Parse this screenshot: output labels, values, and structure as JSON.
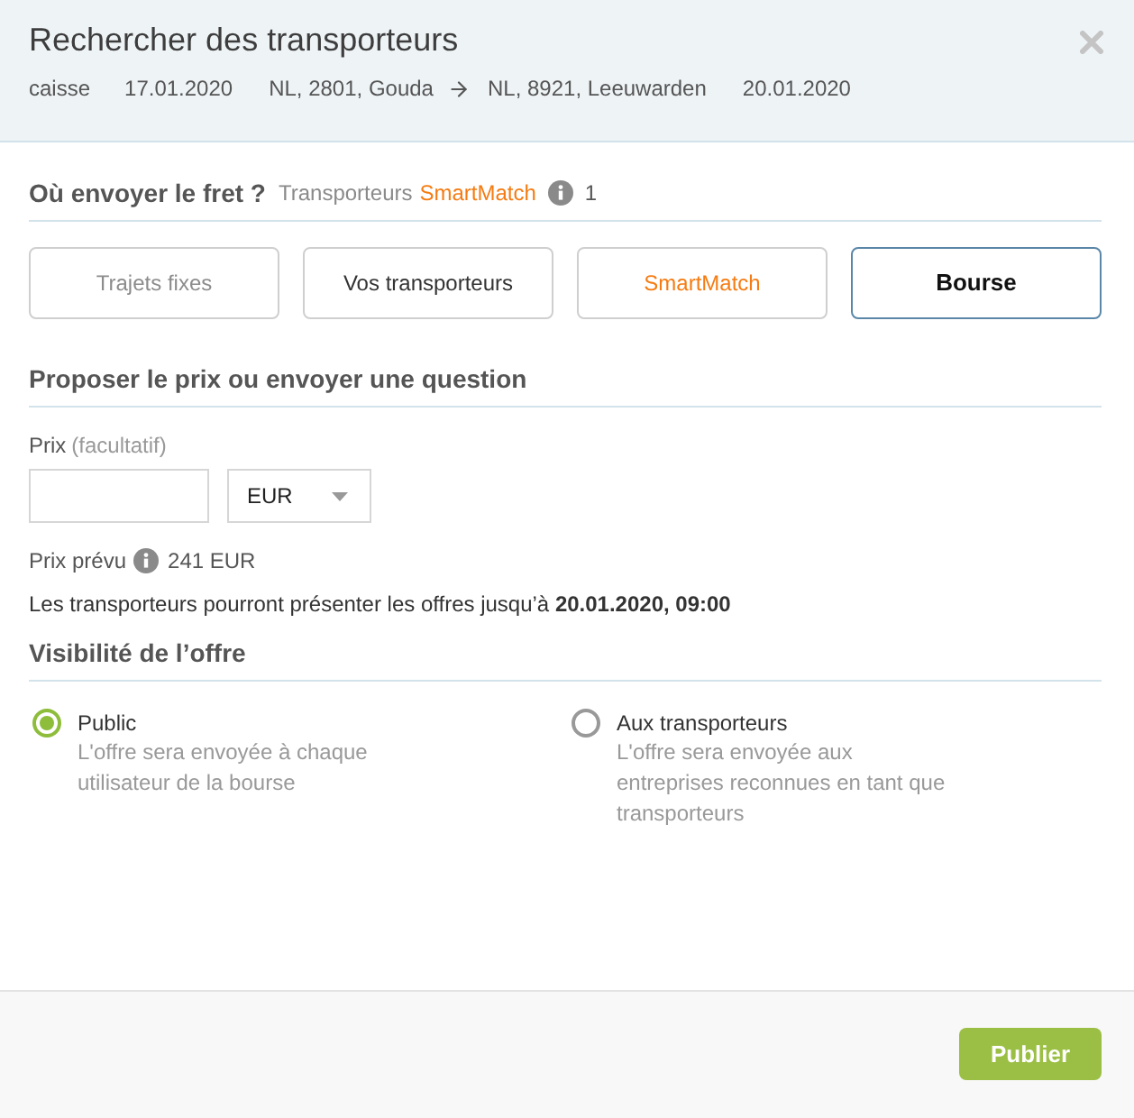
{
  "header": {
    "title": "Rechercher des transporteurs",
    "cargo": "caisse",
    "pickup_date": "17.01.2020",
    "origin": "NL, 2801, Gouda",
    "destination": "NL, 8921, Leeuwarden",
    "delivery_date": "20.01.2020"
  },
  "destination_section": {
    "title": "Où envoyer le fret ?",
    "hint_label": "Transporteurs",
    "hint_brand": "SmartMatch",
    "hint_count": "1"
  },
  "tabs": [
    {
      "label": "Trajets fixes",
      "selected": false,
      "disabled": true,
      "accent": false
    },
    {
      "label": "Vos transporteurs",
      "selected": false,
      "disabled": false,
      "accent": false
    },
    {
      "label": "SmartMatch",
      "selected": false,
      "disabled": false,
      "accent": true
    },
    {
      "label": "Bourse",
      "selected": true,
      "disabled": false,
      "accent": false
    }
  ],
  "price_section": {
    "title": "Proposer le prix ou envoyer une question",
    "price_label": "Prix",
    "price_hint": "(facultatif)",
    "currency": "EUR",
    "expected_label": "Prix prévu",
    "expected_value": "241 EUR",
    "deadline_text": "Les transporteurs pourront présenter les offres jusqu’à **20.01.2020, 09:00**"
  },
  "visibility_section": {
    "title": "Visibilité de l’offre",
    "options": [
      {
        "label": "Public",
        "description": "L'offre sera envoyée à chaque utilisateur de la bourse",
        "selected": true
      },
      {
        "label": "Aux transporteurs",
        "description": "L'offre sera envoyée aux entreprises reconnues en tant que transporteurs",
        "selected": false
      }
    ]
  },
  "footer": {
    "button": "Publier"
  }
}
